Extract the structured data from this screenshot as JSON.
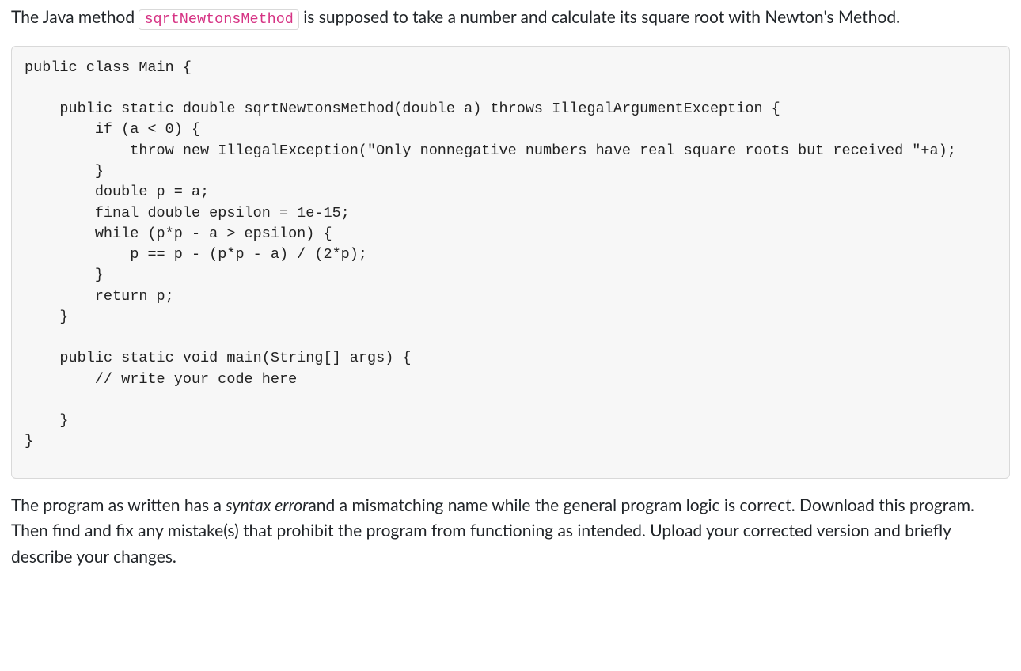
{
  "intro": {
    "pre": "The Java method ",
    "code": "sqrtNewtonsMethod",
    "post": " is supposed to take a number and calculate its square root with Newton's Method."
  },
  "code_block": "public class Main {\n\n    public static double sqrtNewtonsMethod(double a) throws IllegalArgumentException {\n        if (a < 0) {\n            throw new IllegalException(\"Only nonnegative numbers have real square roots but received \"+a);\n        }\n        double p = a;\n        final double epsilon = 1e-15;\n        while (p*p - a > epsilon) {\n            p == p - (p*p - a) / (2*p);\n        }\n        return p;\n    }\n\n    public static void main(String[] args) {\n        // write your code here\n\n    }\n}",
  "outro": {
    "pre": "The program as written has a ",
    "em": "syntax error",
    "post": "and a mismatching name while the general program logic is correct. Download this program. Then find and fix any mistake(s) that prohibit the program from functioning as intended. Upload your corrected version and briefly describe your changes."
  }
}
